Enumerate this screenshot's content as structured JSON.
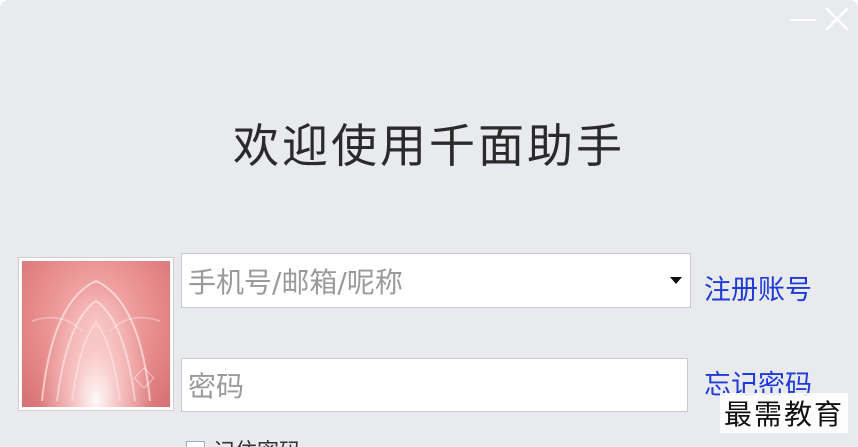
{
  "window": {
    "controls": [
      {
        "name": "minimize-icon",
        "glyph": "—"
      },
      {
        "name": "close-icon",
        "glyph": "✕"
      }
    ]
  },
  "welcome_text": "欢迎使用千面助手",
  "account_field": {
    "placeholder": "手机号/邮箱/呢称",
    "dropdown_icon": "caret-down-icon"
  },
  "password_field": {
    "placeholder": "密码"
  },
  "links": {
    "register": "注册账号",
    "forgot_password": "忘记密码"
  },
  "remember": {
    "label": "记住密码"
  },
  "watermark": "最需教育",
  "colors": {
    "window_bg": "#e9eaee",
    "link": "#1f3bd6",
    "placeholder": "#9a9a9a",
    "title": "#2a2a2a"
  }
}
